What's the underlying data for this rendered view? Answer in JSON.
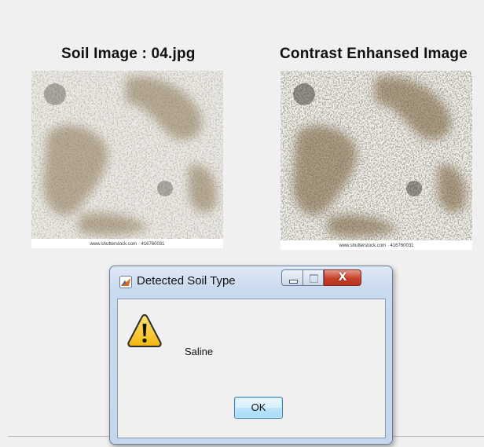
{
  "figure": {
    "left_title": "Soil Image : 04.jpg",
    "right_title": "Contrast Enhansed Image",
    "left_watermark": "www.shutterstock.com · 416760031",
    "right_watermark": "www.shutterstock.com · 416760031"
  },
  "dialog": {
    "title": "Detected Soil Type",
    "message": "Saline",
    "ok_label": "OK",
    "icons": {
      "app": "matlab-icon",
      "message": "warning-icon",
      "minimize": "minimize-icon",
      "maximize": "maximize-icon",
      "close": "close-icon"
    },
    "close_glyph": "X"
  },
  "colors": {
    "background": "#f0f0f0",
    "dialog_frame": "#c6d6ec",
    "close_button": "#c7412a",
    "ok_button": "#bee6fd",
    "warning_yellow": "#f7c21c"
  }
}
